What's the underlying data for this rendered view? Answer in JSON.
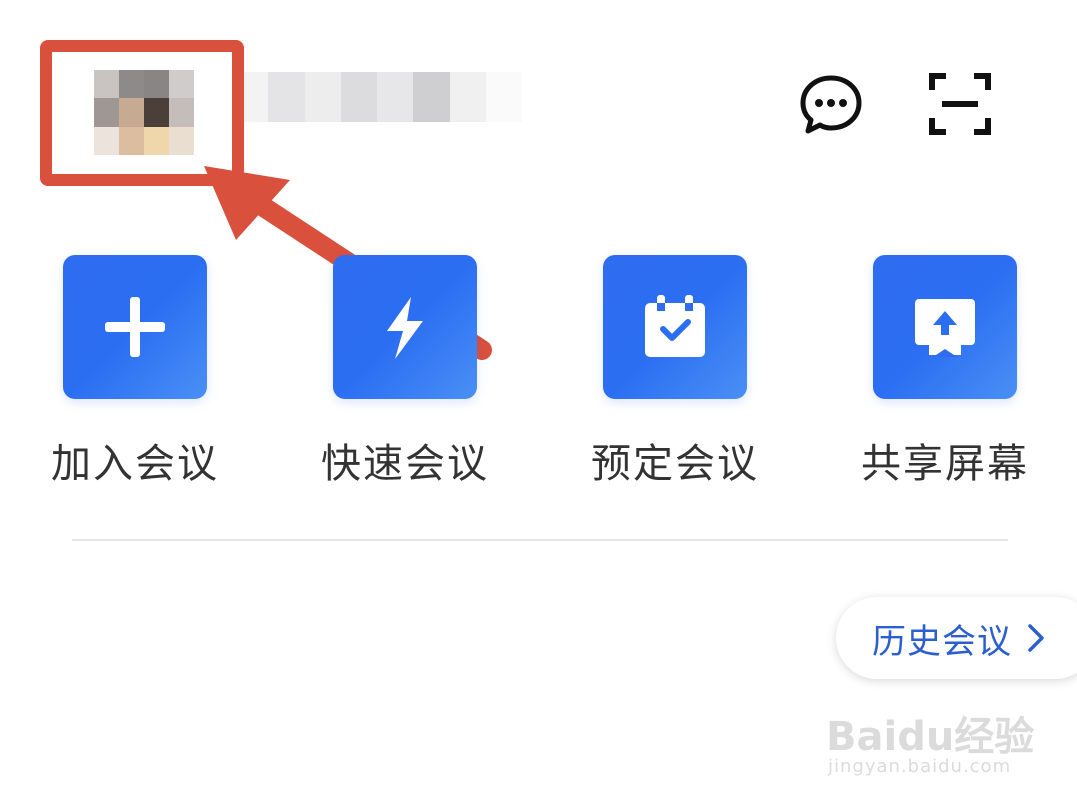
{
  "profile": {
    "avatar_icon": "pixelated-avatar",
    "username": ""
  },
  "header": {
    "message_icon": "message-bubble-icon",
    "scan_icon": "scan-icon"
  },
  "actions": [
    {
      "label": "加入会议",
      "icon": "plus-icon"
    },
    {
      "label": "快速会议",
      "icon": "lightning-icon"
    },
    {
      "label": "预定会议",
      "icon": "calendar-check-icon"
    },
    {
      "label": "共享屏幕",
      "icon": "share-screen-icon"
    }
  ],
  "history": {
    "label": "历史会议",
    "icon": "chevron-right-icon"
  },
  "watermark": {
    "brand": "Baidu经验",
    "url": "jingyan.baidu.com"
  },
  "colors": {
    "accent": "#2b6ef2",
    "highlight": "#d9503d",
    "link": "#2b5fd0"
  }
}
